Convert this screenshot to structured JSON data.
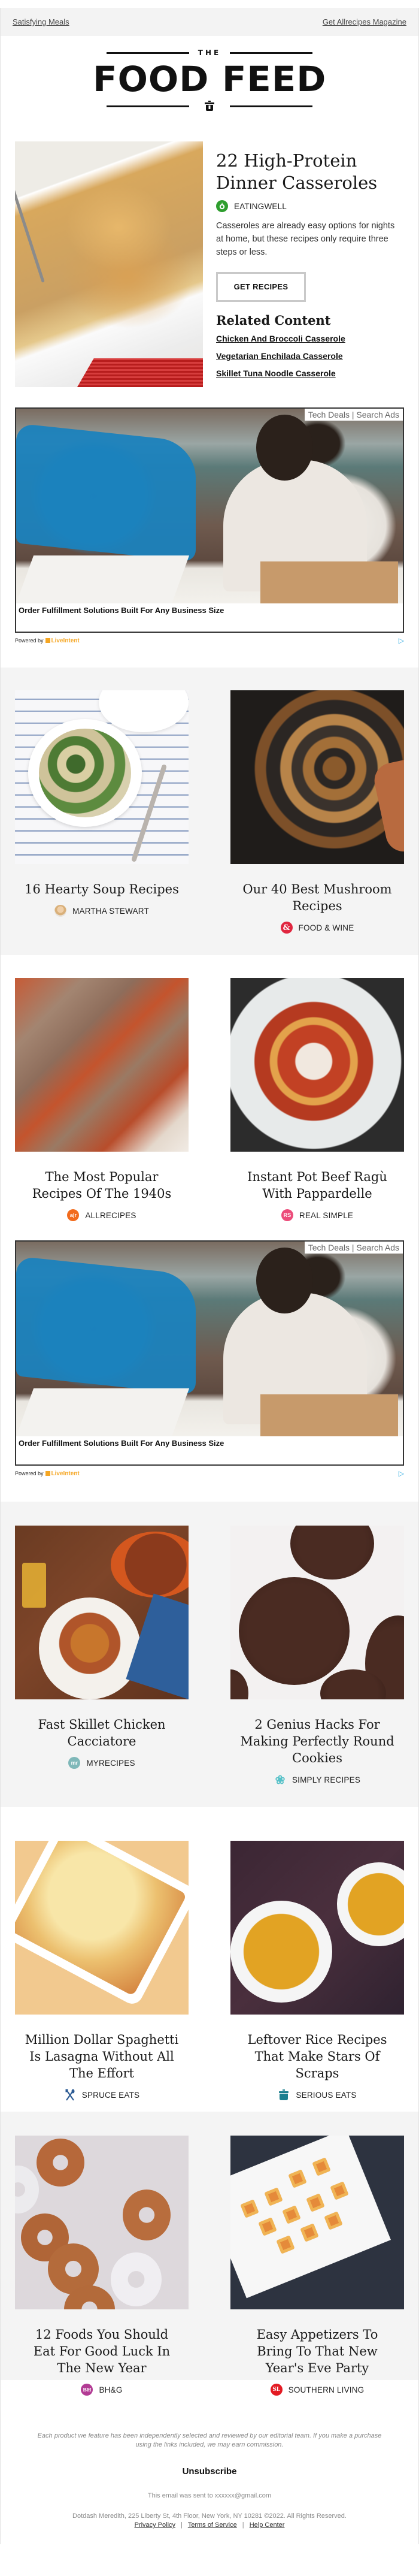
{
  "topbar": {
    "left_link": "Satisfying Meals",
    "right_link": "Get Allrecipes Magazine"
  },
  "logo": {
    "small": "THE",
    "main": "FOOD FEED",
    "icon": "cooking-pot-icon"
  },
  "hero": {
    "title": "22 High-Protein Dinner Casseroles",
    "source": "EATINGWELL",
    "source_icon": "apple-icon",
    "source_color": "#2e9e2e",
    "description": "Casseroles are already easy options for nights at home, but these recipes only require three steps or less.",
    "button_label": "GET RECIPES",
    "related_title": "Related Content",
    "related_links": [
      "Chicken And Broccoli Casserole",
      "Vegetarian Enchilada Casserole",
      "Skillet Tuna Noodle Casserole"
    ]
  },
  "ads": [
    {
      "tag": "Tech Deals | Search Ads",
      "caption": "Order Fulfillment Solutions Built For Any Business Size",
      "powered_by": "Powered by",
      "brand": "LiveIntent",
      "adchoice": "▷"
    },
    {
      "tag": "Tech Deals | Search Ads",
      "caption": "Order Fulfillment Solutions Built For Any Business Size",
      "powered_by": "Powered by",
      "brand": "LiveIntent",
      "adchoice": "▷"
    }
  ],
  "cards": [
    {
      "title": "16 Hearty Soup Recipes",
      "source": "MARTHA STEWART",
      "icon": "martha-stewart-avatar-icon",
      "icon_color": "#d9a679",
      "icon_text": ""
    },
    {
      "title": "Our 40 Best Mushroom Recipes",
      "source": "FOOD & WINE",
      "icon": "ampersand-icon",
      "icon_color": "#e0263f",
      "icon_text": "&"
    },
    {
      "title": "The Most Popular Recipes Of The 1940s",
      "source": "ALLRECIPES",
      "icon": "allrecipes-icon",
      "icon_color": "#f26b1d",
      "icon_text": "a|r"
    },
    {
      "title": "Instant Pot Beef Ragù With Pappardelle",
      "source": "REAL SIMPLE",
      "icon": "real-simple-icon",
      "icon_color": "#ec4c7a",
      "icon_text": "RS"
    },
    {
      "title": "Fast Skillet Chicken Cacciatore",
      "source": "MYRECIPES",
      "icon": "myrecipes-icon",
      "icon_color": "#7fb8b9",
      "icon_text": "mr"
    },
    {
      "title": "2 Genius Hacks For Making Perfectly Round Cookies",
      "source": "SIMPLY RECIPES",
      "icon": "flower-icon",
      "icon_color": "#56c1c8",
      "icon_text": "❀"
    },
    {
      "title": "Million Dollar Spaghetti Is Lasagna Without All The Effort",
      "source": "SPRUCE EATS",
      "icon": "utensils-icon",
      "icon_color": "#2c5b94",
      "icon_text": ""
    },
    {
      "title": "Leftover Rice Recipes That Make Stars Of Scraps",
      "source": "SERIOUS EATS",
      "icon": "pot-icon",
      "icon_color": "#1c7f8f",
      "icon_text": ""
    },
    {
      "title": "12 Foods You Should Eat For Good Luck In The New Year",
      "source": "BH&G",
      "icon": "bhg-icon",
      "icon_color": "#b23b94",
      "icon_text": "BH"
    },
    {
      "title": "Easy Appetizers To Bring To That New Year's Eve Party",
      "source": "SOUTHERN LIVING",
      "icon": "southern-living-icon",
      "icon_color": "#e31b23",
      "icon_text": "SL"
    }
  ],
  "footer": {
    "disclaimer": "Each product we feature has been independently selected and reviewed by our editorial team. If you make a purchase using the links included, we may earn commission.",
    "unsubscribe": "Unsubscribe",
    "sent_to": "This email was sent to xxxxxx@gmail.com",
    "address": "Dotdash Meredith, 225 Liberty St, 4th Floor, New York, NY 10281 ©2022. All Rights Reserved.",
    "links": [
      "Privacy Policy",
      "Terms of Service",
      "Help Center"
    ],
    "separator": "|"
  }
}
